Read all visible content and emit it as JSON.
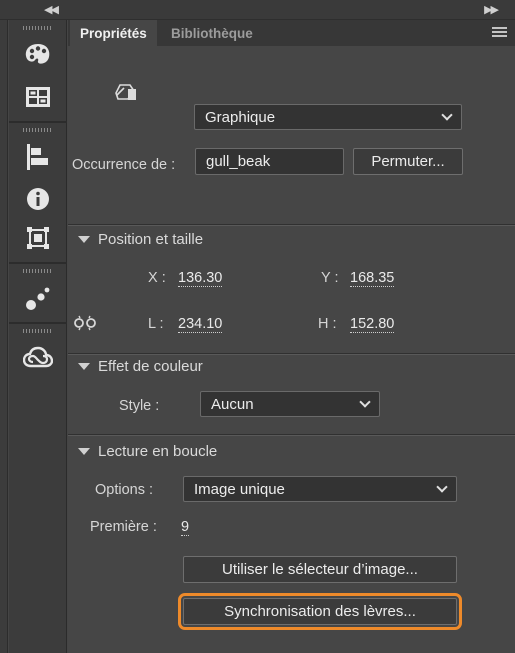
{
  "window": {
    "collapse_left_icon": "double-chevron-left-icon",
    "collapse_right_icon": "double-chevron-right-icon"
  },
  "toolstrip": {
    "tools": [
      "palette-icon",
      "swatches-icon",
      "align-icon",
      "info-icon",
      "transform-icon",
      "motion-presets-icon",
      "cc-libraries-icon"
    ]
  },
  "tabs": {
    "active": "Propriétés",
    "inactive": "Bibliothèque"
  },
  "symbol": {
    "type_icon": "graphic-symbol-icon",
    "type_value": "Graphique",
    "instance_label": "Occurrence de :",
    "instance_value": "gull_beak",
    "swap_button": "Permuter..."
  },
  "position_size": {
    "title": "Position et taille",
    "x_label": "X :",
    "x_value": "136.30",
    "y_label": "Y :",
    "y_value": "168.35",
    "link_icon": "link-dimensions-icon",
    "w_label": "L :",
    "w_value": "234.10",
    "h_label": "H :",
    "h_value": "152.80"
  },
  "color_effect": {
    "title": "Effet de couleur",
    "style_label": "Style :",
    "style_value": "Aucun"
  },
  "looping": {
    "title": "Lecture en boucle",
    "options_label": "Options :",
    "options_value": "Image unique",
    "first_label": "Première :",
    "first_value": "9",
    "frame_picker_button": "Utiliser le sélecteur d’image...",
    "lip_sync_button": "Synchronisation des lèvres..."
  },
  "colors": {
    "panel_bg": "#464646",
    "highlight": "#ee8a2a"
  }
}
